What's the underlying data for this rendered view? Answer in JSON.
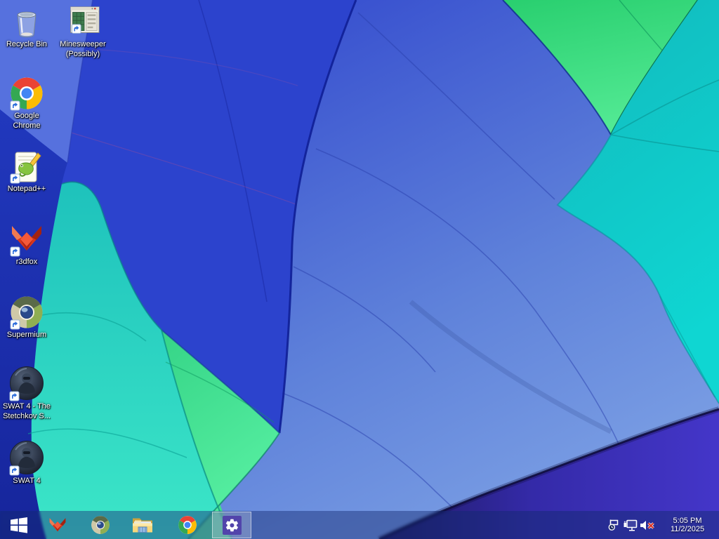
{
  "wallpaper": {
    "theme": "hot-air-balloon-canopy",
    "colors": {
      "royal_blue": "#2c43cd",
      "periwinkle": "#5671de",
      "navy": "#1e33b2",
      "teal_band": "#2bd4c2",
      "green_gore": "#3fdd8f",
      "light_blue_lobe": "#6285dc",
      "teal_right": "#10c9c6",
      "indigo_wedge": "#342aa8"
    }
  },
  "desktop": {
    "icons": [
      {
        "id": "recycle-bin",
        "label": "Recycle Bin",
        "line1": "Recycle Bin",
        "line2": ""
      },
      {
        "id": "minesweeper",
        "label": "Minesweeper (Possibly)",
        "line1": "Minesweeper",
        "line2": "(Possibly)"
      },
      {
        "id": "google-chrome",
        "label": "Google Chrome",
        "line1": "Google",
        "line2": "Chrome"
      },
      {
        "id": "notepad-plus-plus",
        "label": "Notepad++",
        "line1": "Notepad++",
        "line2": ""
      },
      {
        "id": "r3dfox",
        "label": "r3dfox",
        "line1": "r3dfox",
        "line2": ""
      },
      {
        "id": "supermium",
        "label": "Supermium",
        "line1": "Supermium",
        "line2": ""
      },
      {
        "id": "swat4-stetchkov",
        "label": "SWAT 4 - The Stetchkov S...",
        "line1": "SWAT 4 - The",
        "line2": "Stetchkov S..."
      },
      {
        "id": "swat4",
        "label": "SWAT 4",
        "line1": "SWAT 4",
        "line2": ""
      }
    ]
  },
  "taskbar": {
    "pinned": [
      {
        "id": "r3dfox"
      },
      {
        "id": "supermium"
      },
      {
        "id": "file-explorer"
      },
      {
        "id": "google-chrome"
      },
      {
        "id": "settings",
        "active": true
      }
    ],
    "tray": {
      "icons": [
        {
          "id": "action-center"
        },
        {
          "id": "network"
        },
        {
          "id": "volume-muted"
        }
      ],
      "time": "5:05 PM",
      "date": "11/2/2025"
    }
  }
}
